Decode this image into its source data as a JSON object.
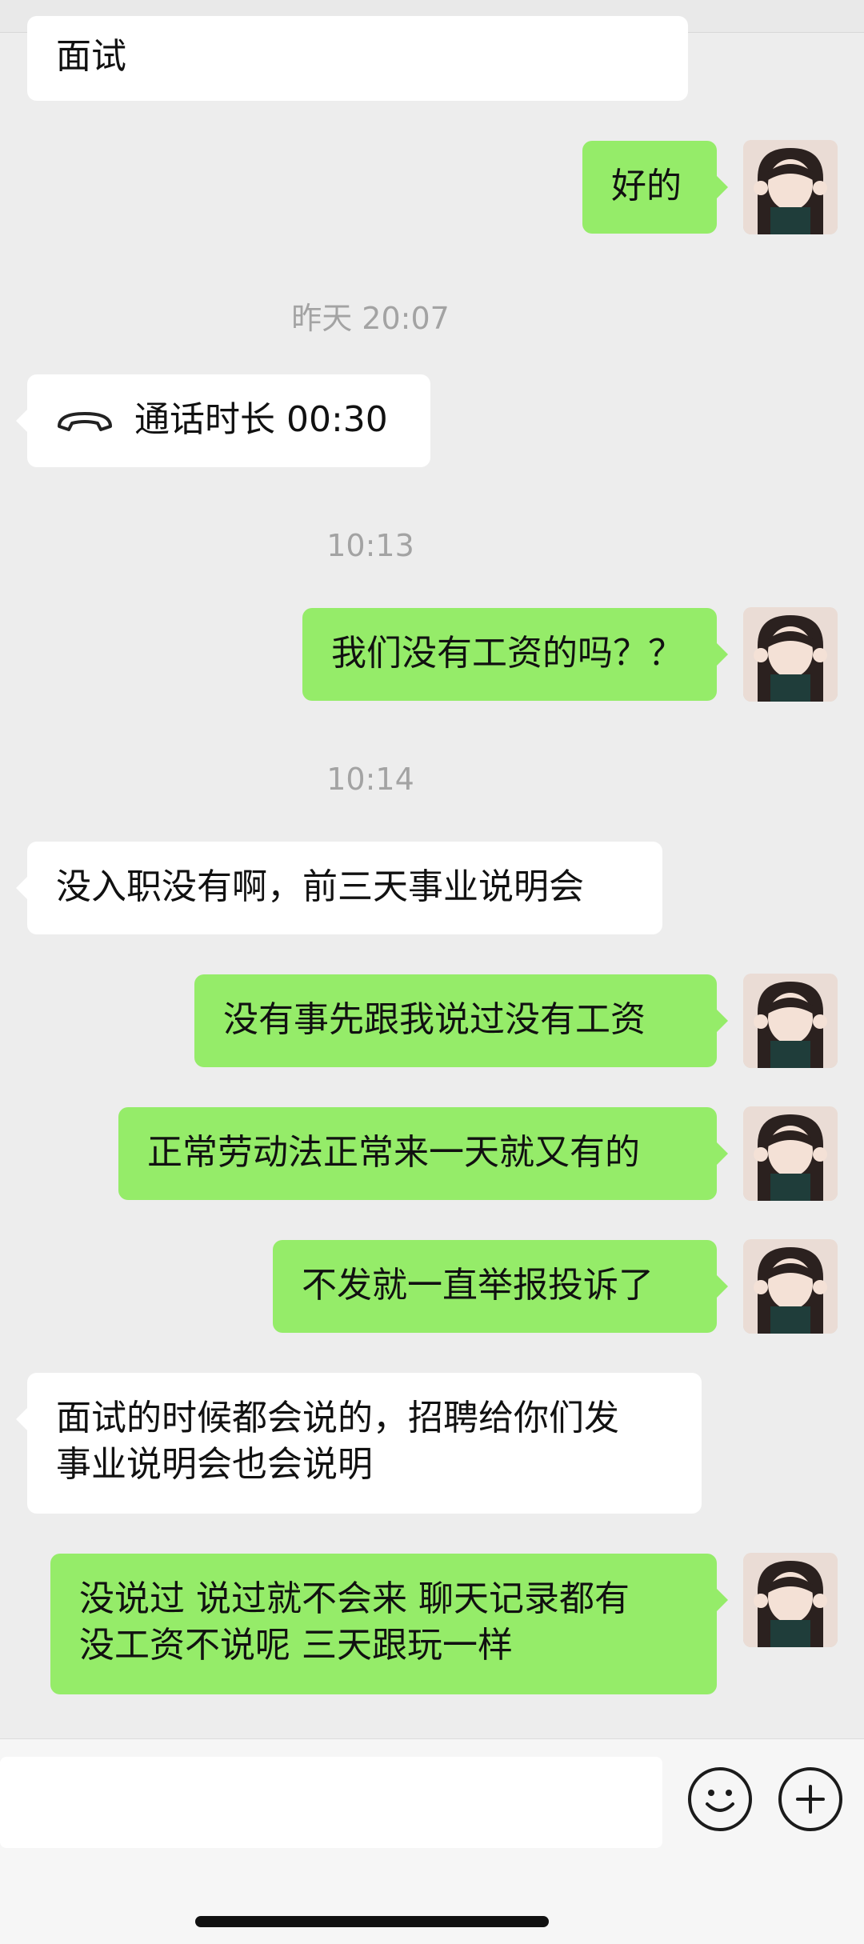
{
  "messages": {
    "m1": "面试",
    "m2": "好的",
    "t1": "昨天 20:07",
    "call": "通话时长 00:30",
    "t2": "10:13",
    "m3": "我们没有工资的吗？？",
    "t3": "10:14",
    "m4": "没入职没有啊，前三天事业说明会",
    "m5": "没有事先跟我说过没有工资",
    "m6": "正常劳动法正常来一天就又有的",
    "m7": "不发就一直举报投诉了",
    "m8_line1": "面试的时候都会说的，招聘给你们发",
    "m8_line2": "事业说明会也会说明",
    "m9_line1": "没说过 说过就不会来 聊天记录都有",
    "m9_line2": "没工资不说呢 三天跟玩一样"
  },
  "icons": {
    "call": "phone-hangup-icon",
    "emoji": "emoji-icon",
    "plus": "plus-icon",
    "avatar": "user-avatar"
  },
  "colors": {
    "bubble_right": "#95ec69",
    "bubble_left": "#ffffff",
    "background": "#ededed"
  }
}
